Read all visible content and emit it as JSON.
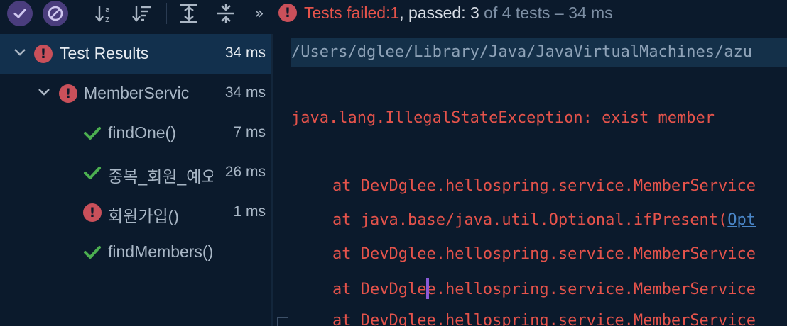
{
  "toolbar": {
    "buttons": [
      {
        "name": "show-passed-button",
        "icon": "check-icon"
      },
      {
        "name": "show-ignored-button",
        "icon": "no-entry-icon"
      },
      {
        "name": "sort-alphabetically-button",
        "icon": "sort-alpha-icon"
      },
      {
        "name": "sort-by-duration-button",
        "icon": "sort-duration-icon"
      },
      {
        "name": "expand-all-button",
        "icon": "expand-all-icon"
      },
      {
        "name": "collapse-all-button",
        "icon": "collapse-all-icon"
      },
      {
        "name": "more-button",
        "icon": "double-chevron-right-icon",
        "label": "»"
      }
    ],
    "summary": {
      "failed_prefix": "Tests failed: ",
      "failed_count": "1",
      "passed_text": ", passed: 3",
      "tail": " of 4 tests – 34 ms"
    }
  },
  "tree": {
    "rows": [
      {
        "label": "Test Results",
        "time": "34 ms",
        "status": "failed",
        "selected": true
      },
      {
        "label": "MemberServic",
        "time": "34 ms",
        "status": "failed",
        "selected": false
      },
      {
        "label": "findOne()",
        "time": "7 ms",
        "status": "passed",
        "selected": false
      },
      {
        "label": "중복_회원_예오",
        "time": "26 ms",
        "status": "passed",
        "selected": false
      },
      {
        "label": "회원가입()",
        "time": "1 ms",
        "status": "failed",
        "selected": false
      },
      {
        "label": "findMembers()",
        "time": "",
        "status": "passed",
        "selected": false
      }
    ]
  },
  "console": {
    "path": "/Users/dglee/Library/Java/JavaVirtualMachines/azu",
    "exception": "java.lang.IllegalStateException: exist member",
    "stack": [
      {
        "text": "at DevDglee.hellospring.service.MemberService"
      },
      {
        "text": "at java.base/java.util.Optional.ifPresent(",
        "link": "Opt"
      },
      {
        "text": "at DevDglee.hellospring.service.MemberService"
      },
      {
        "text_before_caret": "at DevDgle",
        "text_after_caret": "e.hellospring.service.MemberService"
      },
      {
        "text": "at DevDglee.hellospring.service.MemberService"
      }
    ]
  },
  "colors": {
    "background": "#0b1a2c",
    "selection": "#12304d",
    "error": "#e5534b",
    "success": "#4caf50",
    "toggle_active": "#4a3d7d"
  }
}
